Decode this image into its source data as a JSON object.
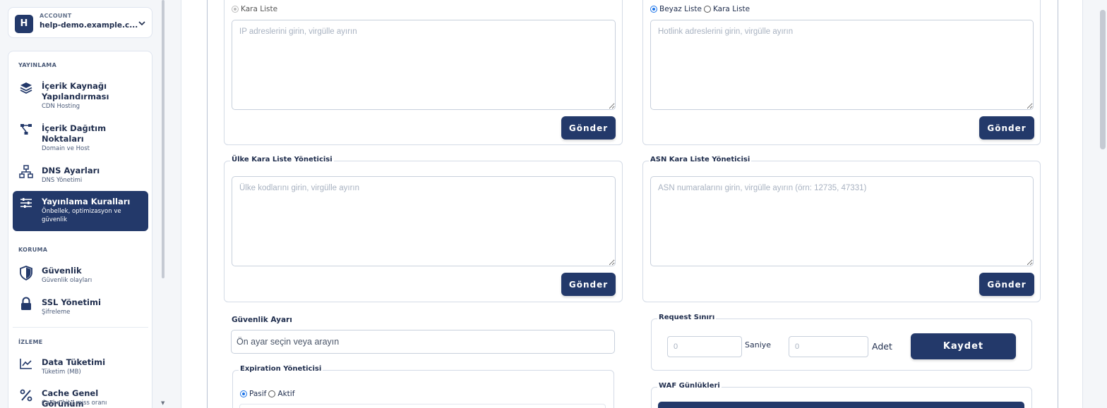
{
  "account": {
    "avatar_letter": "H",
    "kicker": "ACCOUNT",
    "domain": "help-demo.example.c..."
  },
  "sidebar": {
    "sections": {
      "yayinlama": "YAYINLAMA",
      "koruma": "KORUMA",
      "izleme": "İZLEME"
    },
    "items": [
      {
        "title": "İçerik Kaynağı Yapılandırması",
        "sub": "CDN Hosting",
        "icon": "layers-icon"
      },
      {
        "title": "İçerik Dağıtım Noktaları",
        "sub": "Domain ve Host",
        "icon": "network-icon"
      },
      {
        "title": "DNS Ayarları",
        "sub": "DNS Yönetimi",
        "icon": "sitemap-icon"
      },
      {
        "title": "Yayınlama Kuralları",
        "sub": "Önbellek, optimizasyon ve güvenlik",
        "icon": "sliders-icon",
        "active": true
      },
      {
        "title": "Güvenlik",
        "sub": "Güvenlik olayları",
        "icon": "shield-icon"
      },
      {
        "title": "SSL Yönetimi",
        "sub": "Şifreleme",
        "icon": "lock-icon"
      },
      {
        "title": "Data Tüketimi",
        "sub": "Tüketim (MB)",
        "icon": "chart-line-icon"
      },
      {
        "title": "Cache Genel Görünüm",
        "sub": "Cache hit / miss oranı",
        "icon": "percent-icon"
      }
    ]
  },
  "ip_panel": {
    "radio_label": "Kara Liste",
    "placeholder": "IP adreslerini girin, virgülle ayırın",
    "submit": "Gönder"
  },
  "hotlink_panel": {
    "radio_white": "Beyaz Liste",
    "radio_black": "Kara Liste",
    "placeholder": "Hotlink adreslerini girin, virgülle ayırın",
    "submit": "Gönder"
  },
  "country_panel": {
    "legend": "Ülke Kara Liste Yöneticisi",
    "placeholder": "Ülke kodlarını girin, virgülle ayırın",
    "submit": "Gönder"
  },
  "asn_panel": {
    "legend": "ASN Kara Liste Yöneticisi",
    "placeholder": "ASN numaralarını girin, virgülle ayırın (örn: 12735, 47331)",
    "submit": "Gönder"
  },
  "security_setting": {
    "label": "Güvenlik Ayarı",
    "placeholder": "Ön ayar seçin veya arayın"
  },
  "request_limit": {
    "legend": "Request Sınırı",
    "seconds_placeholder": "0",
    "seconds_unit": "Saniye",
    "count_placeholder": "0",
    "count_unit": "Adet",
    "save": "Kaydet"
  },
  "expiration": {
    "legend": "Expiration Yöneticisi",
    "radio_passive": "Pasif",
    "radio_active": "Aktif"
  },
  "waf": {
    "legend": "WAF Günlükleri"
  },
  "colors": {
    "primary": "#23396a",
    "radio_blue": "#1a73e8"
  }
}
